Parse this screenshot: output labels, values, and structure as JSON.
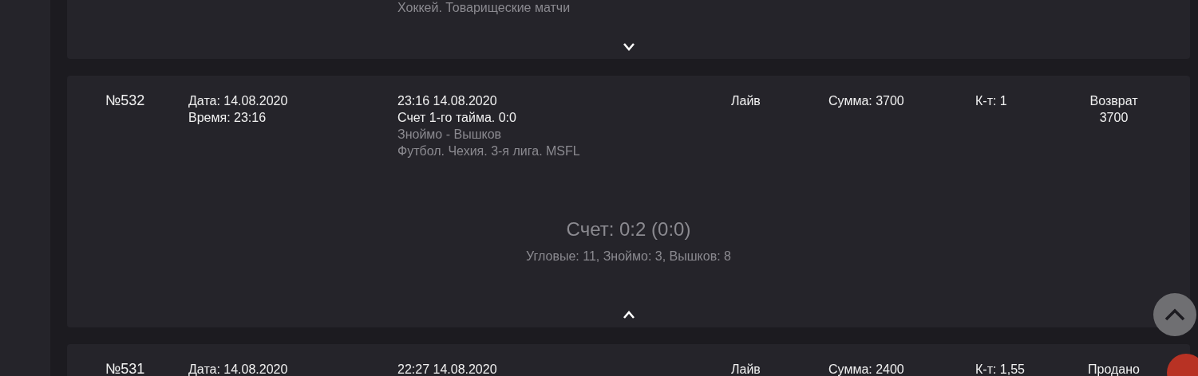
{
  "bets": [
    {
      "league": "Хоккей. Товарищеские матчи",
      "expanded": false,
      "show_toggle": true
    },
    {
      "number": "№532",
      "date": "Дата: 14.08.2020",
      "time": "Время: 23:16",
      "event_time": "23:16 14.08.2020",
      "market": "Счет 1-го тайма. 0:0",
      "teams": "Зноймо - Вышков",
      "league": "Футбол. Чехия. 3-я лига. MSFL",
      "type": "Лайв",
      "amount": "Сумма: 3700",
      "odds": "К-т: 1",
      "result": [
        "Возврат",
        "3700"
      ],
      "score": "Счет: 0:2 (0:0)",
      "stats": "Угловые: 11, Зноймо: 3, Вышков: 8",
      "expanded": true,
      "show_toggle": true
    },
    {
      "number": "№531",
      "date": "Дата: 14.08.2020",
      "event_time": "22:27 14.08.2020",
      "type": "Лайв",
      "amount": "Сумма: 2400",
      "odds": "К-т: 1,55",
      "result": [
        "Продано"
      ],
      "expanded": false,
      "show_toggle": false
    }
  ]
}
